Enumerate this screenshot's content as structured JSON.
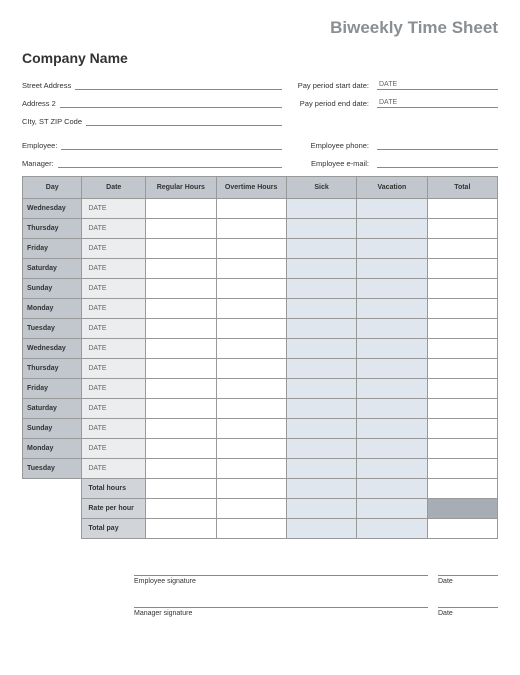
{
  "title": "Biweekly Time Sheet",
  "company": "Company Name",
  "info": {
    "street_label": "Street Address",
    "addr2_label": "Address 2",
    "csz_label": "CIty, ST  ZIP Code",
    "employee_label": "Employee:",
    "manager_label": "Manager:",
    "pay_start_label": "Pay period start date:",
    "pay_end_label": "Pay period end date:",
    "emp_phone_label": "Employee phone:",
    "emp_email_label": "Employee e-mail:",
    "pay_start_value": "DATE",
    "pay_end_value": "DATE"
  },
  "columns": {
    "day": "Day",
    "date": "Date",
    "regular": "Regular Hours",
    "overtime": "Overtime Hours",
    "sick": "Sick",
    "vacation": "Vacation",
    "total": "Total"
  },
  "rows": [
    {
      "day": "Wednesday",
      "date": "DATE"
    },
    {
      "day": "Thursday",
      "date": "DATE"
    },
    {
      "day": "Friday",
      "date": "DATE"
    },
    {
      "day": "Saturday",
      "date": "DATE"
    },
    {
      "day": "Sunday",
      "date": "DATE"
    },
    {
      "day": "Monday",
      "date": "DATE"
    },
    {
      "day": "Tuesday",
      "date": "DATE"
    },
    {
      "day": "Wednesday",
      "date": "DATE"
    },
    {
      "day": "Thursday",
      "date": "DATE"
    },
    {
      "day": "Friday",
      "date": "DATE"
    },
    {
      "day": "Saturday",
      "date": "DATE"
    },
    {
      "day": "Sunday",
      "date": "DATE"
    },
    {
      "day": "Monday",
      "date": "DATE"
    },
    {
      "day": "Tuesday",
      "date": "DATE"
    }
  ],
  "summary": {
    "total_hours": "Total hours",
    "rate_per_hour": "Rate per hour",
    "total_pay": "Total pay"
  },
  "signatures": {
    "employee": "Employee signature",
    "manager": "Manager signature",
    "date": "Date"
  }
}
